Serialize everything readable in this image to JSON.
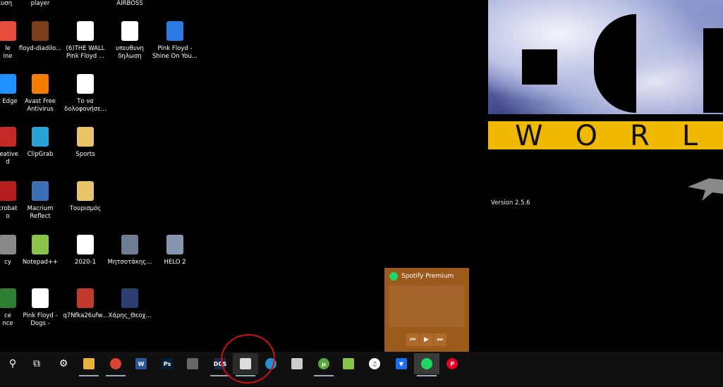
{
  "desktop": {
    "top_labels": [
      "ευση",
      "player",
      "AIRBOSS"
    ],
    "icons": [
      {
        "label": "le\nine",
        "col": 0,
        "row": 0
      },
      {
        "label": "floyd-diadilo...",
        "col": 1,
        "row": 0
      },
      {
        "label": "(6)THE WALL\nPink Floyd ...",
        "col": 2,
        "row": 0
      },
      {
        "label": "υπευθυνη\nδηλωση",
        "col": 3,
        "row": 0
      },
      {
        "label": "Pink Floyd -\nShine On You...",
        "col": 4,
        "row": 0
      },
      {
        "label": "t Edge",
        "col": 0,
        "row": 1
      },
      {
        "label": "Avast Free\nAntivirus",
        "col": 1,
        "row": 1
      },
      {
        "label": "Το να\nδολοφονήσε...",
        "col": 2,
        "row": 1
      },
      {
        "label": "reative\nd",
        "col": 0,
        "row": 2
      },
      {
        "label": "ClipGrab",
        "col": 1,
        "row": 2
      },
      {
        "label": "Sports",
        "col": 2,
        "row": 2
      },
      {
        "label": "crobat\no",
        "col": 0,
        "row": 3
      },
      {
        "label": "Macrium\nReflect",
        "col": 1,
        "row": 3
      },
      {
        "label": "Τουρισμός",
        "col": 2,
        "row": 3
      },
      {
        "label": "cy",
        "col": 0,
        "row": 4
      },
      {
        "label": "Notepad++",
        "col": 1,
        "row": 4
      },
      {
        "label": "2020-1",
        "col": 2,
        "row": 4
      },
      {
        "label": "Μητσοτάκης...",
        "col": 3,
        "row": 4
      },
      {
        "label": "HELO 2",
        "col": 4,
        "row": 4
      },
      {
        "label": "ce\nnce",
        "col": 0,
        "row": 5
      },
      {
        "label": "Pink Floyd -\nDogs -",
        "col": 1,
        "row": 5
      },
      {
        "label": "q7Nfka26ufw...",
        "col": 2,
        "row": 5
      },
      {
        "label": "Χάρης_Θεοχ...",
        "col": 3,
        "row": 5
      }
    ]
  },
  "splash": {
    "band_text": "WORL",
    "version": "Version 2.5.6",
    "band_color": "#f0b800"
  },
  "spotify": {
    "title": "Spotify Premium",
    "prev": "⏮",
    "play": "▶",
    "next": "⏭"
  },
  "taskbar": {
    "items": [
      {
        "name": "search-button",
        "glyph": "⚲"
      },
      {
        "name": "task-view-button",
        "glyph": "⧉"
      },
      {
        "name": "settings-button",
        "glyph": "⚙"
      },
      {
        "name": "file-explorer-button",
        "glyph": ""
      },
      {
        "name": "chrome-button",
        "glyph": ""
      },
      {
        "name": "word-button",
        "glyph": "W"
      },
      {
        "name": "photoshop-button",
        "glyph": "Ps"
      },
      {
        "name": "app-button",
        "glyph": ""
      },
      {
        "name": "dcs-button",
        "glyph": "DCS"
      },
      {
        "name": "active-window-button",
        "glyph": ""
      },
      {
        "name": "globe-button",
        "glyph": ""
      },
      {
        "name": "app2-button",
        "glyph": ""
      },
      {
        "name": "utorrent-button",
        "glyph": "µ"
      },
      {
        "name": "notepad-button",
        "glyph": ""
      },
      {
        "name": "itunes-button",
        "glyph": "♫"
      },
      {
        "name": "vpn-button",
        "glyph": "▼"
      },
      {
        "name": "spotify-button",
        "glyph": ""
      },
      {
        "name": "pinterest-button",
        "glyph": "P"
      }
    ]
  }
}
